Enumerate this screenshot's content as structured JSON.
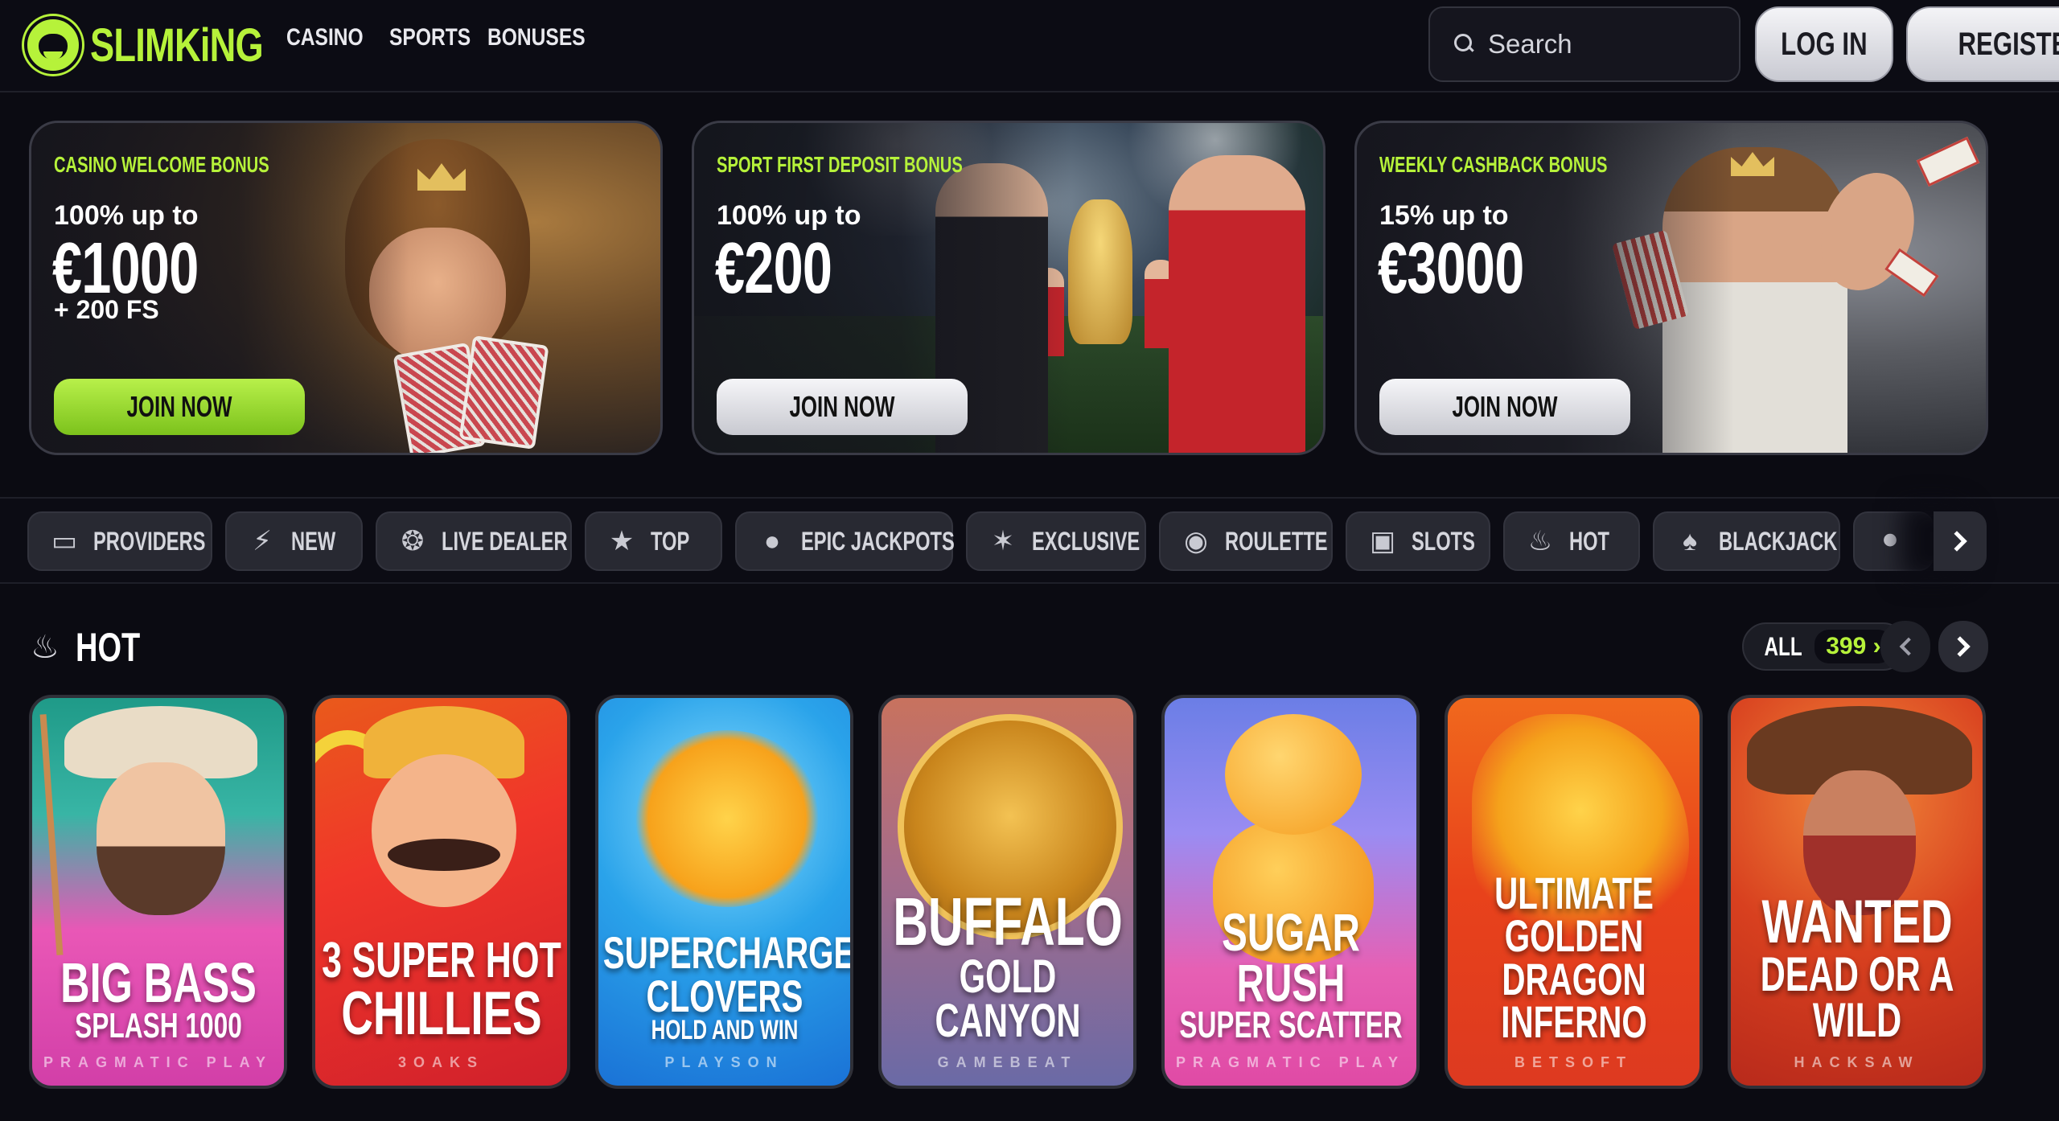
{
  "brand": {
    "name_part1": "SLIM",
    "name_part2": "KiNG"
  },
  "nav": {
    "casino": "CASINO",
    "sports": "SPORTS",
    "bonuses": "BONUSES"
  },
  "search": {
    "placeholder": "Search"
  },
  "auth": {
    "login": "LOG IN",
    "register": "REGISTER"
  },
  "promos": [
    {
      "label": "CASINO WELCOME BONUS",
      "upto": "100% up to",
      "amount": "€1000",
      "extra": "+ 200 FS",
      "cta": "JOIN NOW",
      "accent": "#b6f23a"
    },
    {
      "label": "SPORT FIRST DEPOSIT BONUS",
      "upto": "100% up to",
      "amount": "€200",
      "extra": "",
      "cta": "JOIN NOW"
    },
    {
      "label": "WEEKLY CASHBACK BONUS",
      "upto": "15% up to",
      "amount": "€3000",
      "extra": "",
      "cta": "JOIN NOW"
    }
  ],
  "categories": [
    {
      "label": "PROVIDERS",
      "icon": "book-icon"
    },
    {
      "label": "NEW",
      "icon": "lightning-icon"
    },
    {
      "label": "LIVE DEALER",
      "icon": "poker-chip-icon"
    },
    {
      "label": "TOP",
      "icon": "trophy-icon"
    },
    {
      "label": "EPIC JACKPOTS",
      "icon": "coins-icon"
    },
    {
      "label": "EXCLUSIVE",
      "icon": "sparkle-icon"
    },
    {
      "label": "ROULETTE",
      "icon": "roulette-icon"
    },
    {
      "label": "SLOTS",
      "icon": "slot-machine-icon"
    },
    {
      "label": "HOT",
      "icon": "fire-icon"
    },
    {
      "label": "BLACKJACK",
      "icon": "cards-icon"
    },
    {
      "label": "",
      "icon": "microphone-icon"
    }
  ],
  "hot": {
    "title": "HOT",
    "all_label": "ALL",
    "count": "399",
    "games": [
      {
        "line1": "BIG BASS",
        "line2": "SPLASH 1000",
        "line3": "",
        "provider": "PRAGMATIC PLAY"
      },
      {
        "line1": "3 SUPER HOT",
        "line2": "CHILLIES",
        "line3": "",
        "provider": "3OAKS"
      },
      {
        "line1": "SUPERCHARGED",
        "line2": "CLOVERS",
        "line3": "HOLD AND WIN",
        "provider": "PLAYSON"
      },
      {
        "line1": "BUFFALO",
        "line2": "GOLD CANYON",
        "line3": "",
        "provider": "GAMEBEAT"
      },
      {
        "line1": "SUGAR RUSH",
        "line2": "SUPER SCATTER",
        "line3": "",
        "provider": "PRAGMATIC PLAY"
      },
      {
        "line1": "ULTIMATE GOLDEN",
        "line2": "DRAGON INFERNO",
        "line3": "",
        "provider": "BETSOFT"
      },
      {
        "line1": "WANTED",
        "line2": "DEAD OR A WILD",
        "line3": "",
        "provider": "HACKSAW"
      }
    ]
  }
}
